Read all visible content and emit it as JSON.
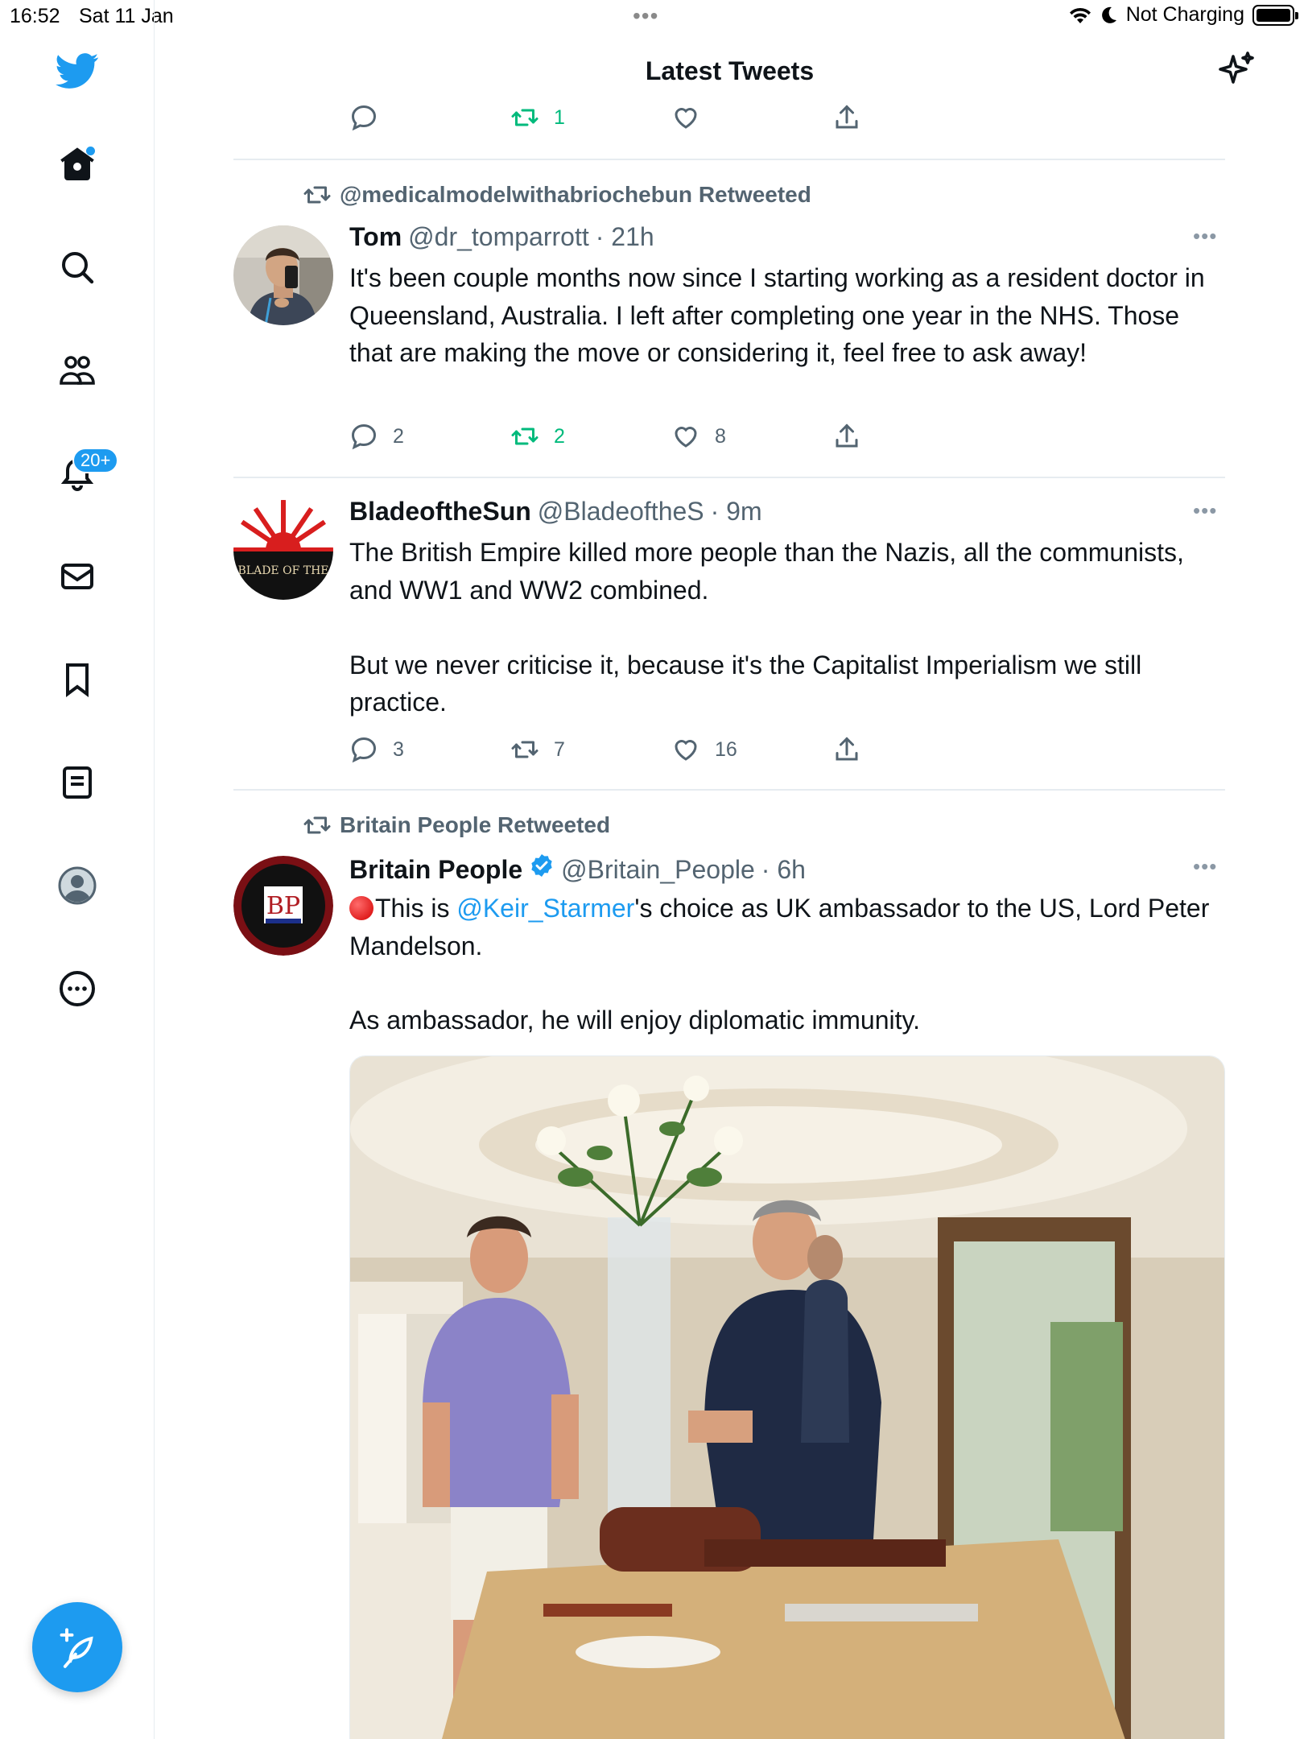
{
  "status_bar": {
    "time": "16:52",
    "date": "Sat 11 Jan",
    "charging": "Not Charging",
    "battery_level": 1.0
  },
  "header": {
    "title": "Latest Tweets"
  },
  "sidebar": {
    "items": [
      {
        "name": "twitter-logo"
      },
      {
        "name": "home"
      },
      {
        "name": "search"
      },
      {
        "name": "communities"
      },
      {
        "name": "notifications",
        "badge": "20+"
      },
      {
        "name": "messages"
      },
      {
        "name": "bookmarks"
      },
      {
        "name": "lists"
      },
      {
        "name": "profile"
      },
      {
        "name": "more"
      }
    ]
  },
  "top_actions": {
    "retweets": "1"
  },
  "tweets": [
    {
      "retweeted_by": "@medicalmodelwithabriochebun Retweeted",
      "display_name": "Tom",
      "handle": "@dr_tomparrott",
      "time": "· 21h",
      "text": "It's been couple months now since I starting working as a resident doctor in Queensland, Australia. I left after completing one year in the NHS. Those that are making the move or considering it, feel free to ask away!",
      "replies": "2",
      "retweets": "2",
      "likes": "8"
    },
    {
      "display_name": "BladeoftheSun",
      "handle": "@BladeoftheS",
      "time": "· 9m",
      "avatar_text": "BLADE OF THE",
      "text": "The British Empire killed more people than the Nazis, all the communists, and WW1 and WW2 combined.\n\nBut we never criticise it, because it's the Capitalist Imperialism we still practice.",
      "replies": "3",
      "retweets": "7",
      "likes": "16"
    },
    {
      "retweeted_by": "Britain People Retweeted",
      "display_name": "Britain People",
      "handle": "@Britain_People",
      "time": "· 6h",
      "avatar_text": "BP",
      "text_prefix": "This is ",
      "mention": "@Keir_Starmer",
      "text_suffix": "'s choice as UK ambassador to the US, Lord Peter Mandelson.",
      "text_second": "As ambassador, he will enjoy diplomatic immunity."
    }
  ],
  "colors": {
    "accent": "#1d9bf0",
    "retweet_green": "#00ba7c",
    "secondary_text": "#536471"
  }
}
